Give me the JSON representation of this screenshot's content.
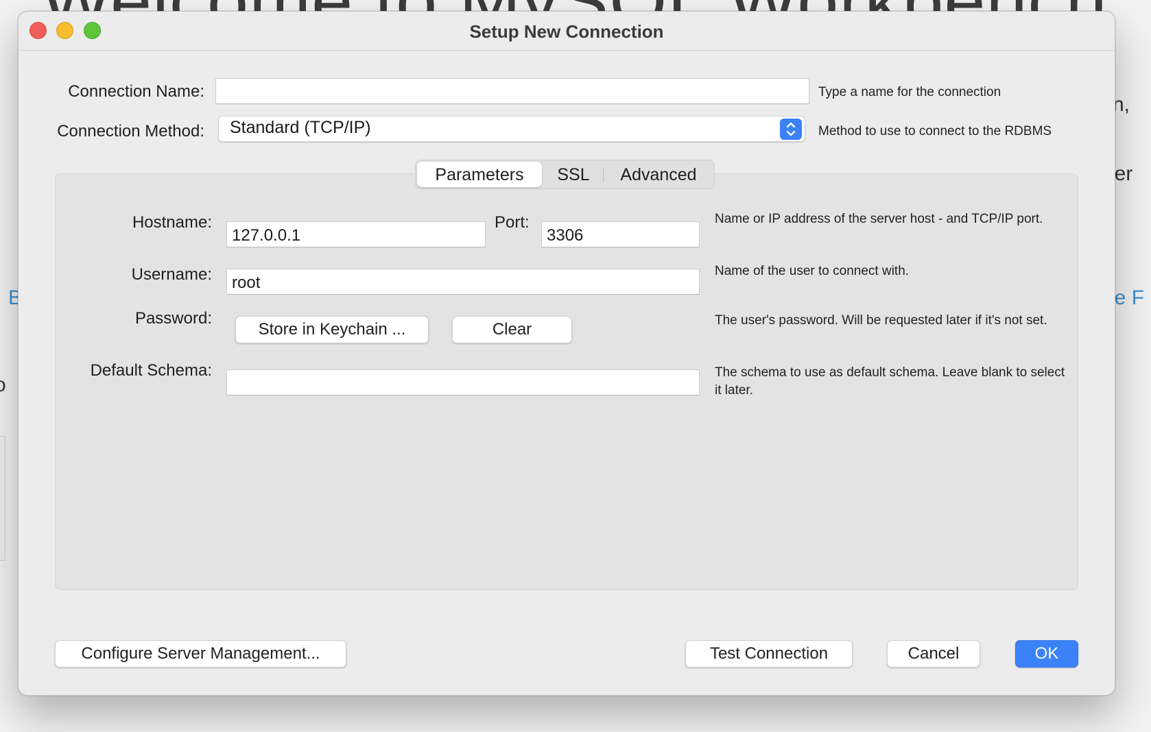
{
  "background": {
    "headline": "Welcome to MySQL Workbench",
    "fragments": {
      "comma": "n,",
      "other": "her",
      "link_left": "B",
      "link_right": "ne F",
      "left_char": "o"
    }
  },
  "window": {
    "title": "Setup New Connection"
  },
  "connection_name": {
    "label": "Connection Name:",
    "value": "",
    "hint": "Type a name for the connection"
  },
  "connection_method": {
    "label": "Connection Method:",
    "value": "Standard (TCP/IP)",
    "hint": "Method to use to connect to the RDBMS"
  },
  "tabs": [
    {
      "label": "Parameters",
      "active": true
    },
    {
      "label": "SSL",
      "active": false
    },
    {
      "label": "Advanced",
      "active": false
    }
  ],
  "parameters": {
    "hostname": {
      "label": "Hostname:",
      "value": "127.0.0.1"
    },
    "port": {
      "label": "Port:",
      "value": "3306"
    },
    "host_hint": "Name or IP address of the server host - and TCP/IP port.",
    "username": {
      "label": "Username:",
      "value": "root",
      "hint": "Name of the user to connect with."
    },
    "password": {
      "label": "Password:",
      "store_button": "Store in Keychain ...",
      "clear_button": "Clear",
      "hint": "The user's password. Will be requested later if it's not set."
    },
    "default_schema": {
      "label": "Default Schema:",
      "value": "",
      "hint": "The schema to use as default schema. Leave blank to select it later."
    }
  },
  "footer": {
    "configure_button": "Configure Server Management...",
    "test_button": "Test Connection",
    "cancel_button": "Cancel",
    "ok_button": "OK"
  },
  "colors": {
    "accent": "#3b82f6",
    "close": "#ee5f57",
    "minimize": "#f5bd2f",
    "maximize": "#5fc43a",
    "background_link": "#3b8fd3"
  }
}
